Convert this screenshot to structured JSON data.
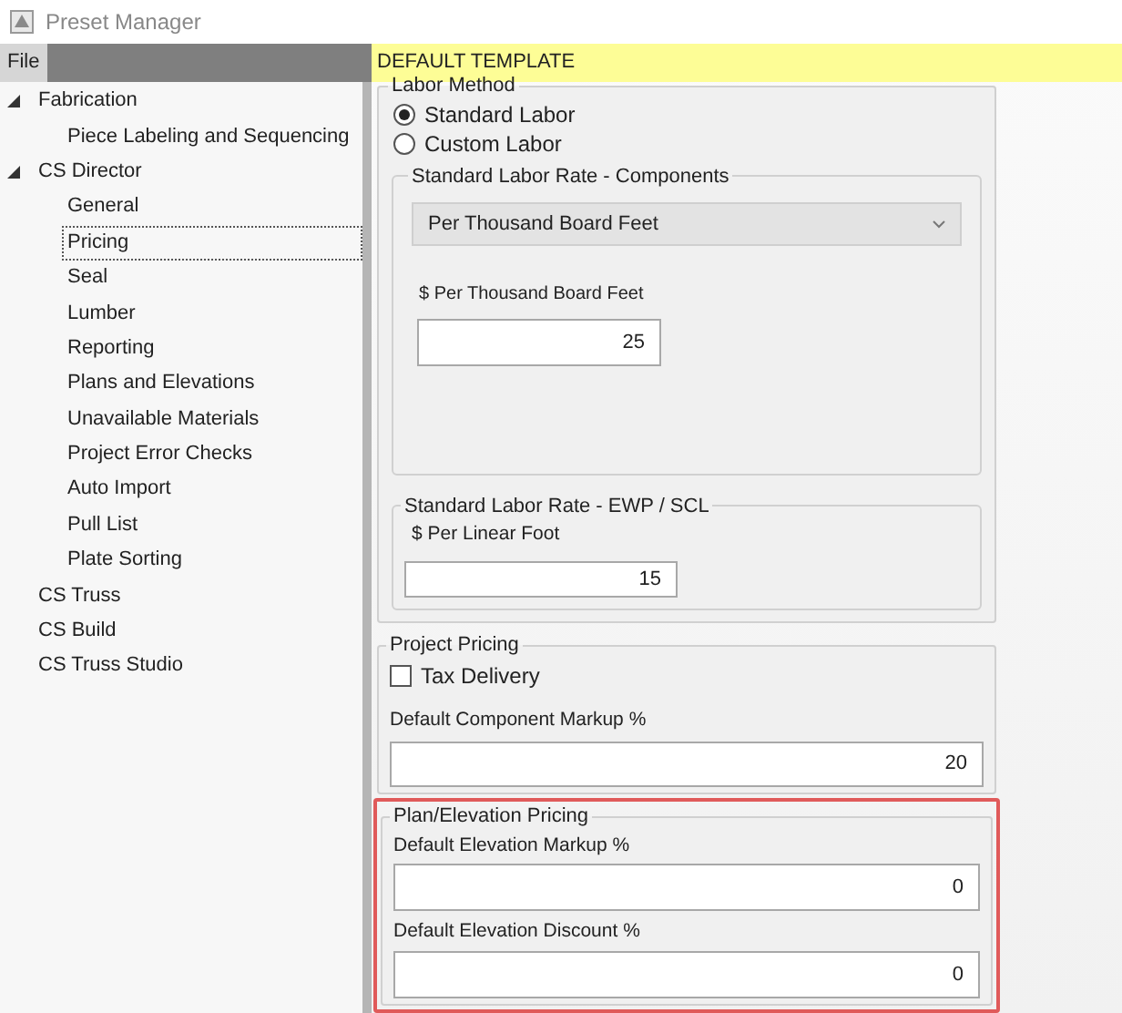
{
  "window": {
    "title": "Preset Manager"
  },
  "menu": [
    "File"
  ],
  "tree": [
    {
      "label": "Fabrication",
      "expanded": true,
      "selected": false,
      "children": [
        {
          "label": "Piece Labeling and Sequencing",
          "selected": false
        }
      ]
    },
    {
      "label": "CS Director",
      "expanded": true,
      "selected": false,
      "children": [
        {
          "label": "General",
          "selected": false
        },
        {
          "label": "Pricing",
          "selected": true
        },
        {
          "label": "Seal",
          "selected": false
        },
        {
          "label": "Lumber",
          "selected": false
        },
        {
          "label": "Reporting",
          "selected": false
        },
        {
          "label": "Plans and Elevations",
          "selected": false
        },
        {
          "label": "Unavailable Materials",
          "selected": false
        },
        {
          "label": "Project Error Checks",
          "selected": false
        },
        {
          "label": "Auto Import",
          "selected": false
        },
        {
          "label": "Pull List",
          "selected": false
        },
        {
          "label": "Plate Sorting",
          "selected": false
        }
      ]
    },
    {
      "label": "CS Truss",
      "selected": false
    },
    {
      "label": "CS Build",
      "selected": false
    },
    {
      "label": "CS Truss Studio",
      "selected": false
    }
  ],
  "header": {
    "title": "DEFAULT TEMPLATE"
  },
  "labor_method": {
    "legend": "Labor Method",
    "options": [
      {
        "label": "Standard Labor",
        "selected": true
      },
      {
        "label": "Custom Labor",
        "selected": false
      }
    ],
    "components_rate": {
      "legend": "Standard Labor Rate - Components",
      "dropdown": {
        "value": "Per Thousand Board Feet"
      },
      "field": {
        "label": "$ Per Thousand Board Feet",
        "value": "25"
      }
    },
    "ewp_rate": {
      "legend": "Standard Labor Rate - EWP / SCL",
      "field": {
        "label": "$ Per Linear Foot",
        "value": "15"
      }
    }
  },
  "project_pricing": {
    "legend": "Project Pricing",
    "tax_delivery": {
      "label": "Tax Delivery",
      "checked": false
    },
    "field": {
      "label": "Default Component Markup %",
      "value": "20"
    }
  },
  "plan_elevation_pricing": {
    "legend": "Plan/Elevation Pricing",
    "highlighted": true,
    "fields": [
      {
        "label": "Default Elevation Markup %",
        "value": "0"
      },
      {
        "label": "Default Elevation Discount %",
        "value": "0"
      }
    ]
  }
}
